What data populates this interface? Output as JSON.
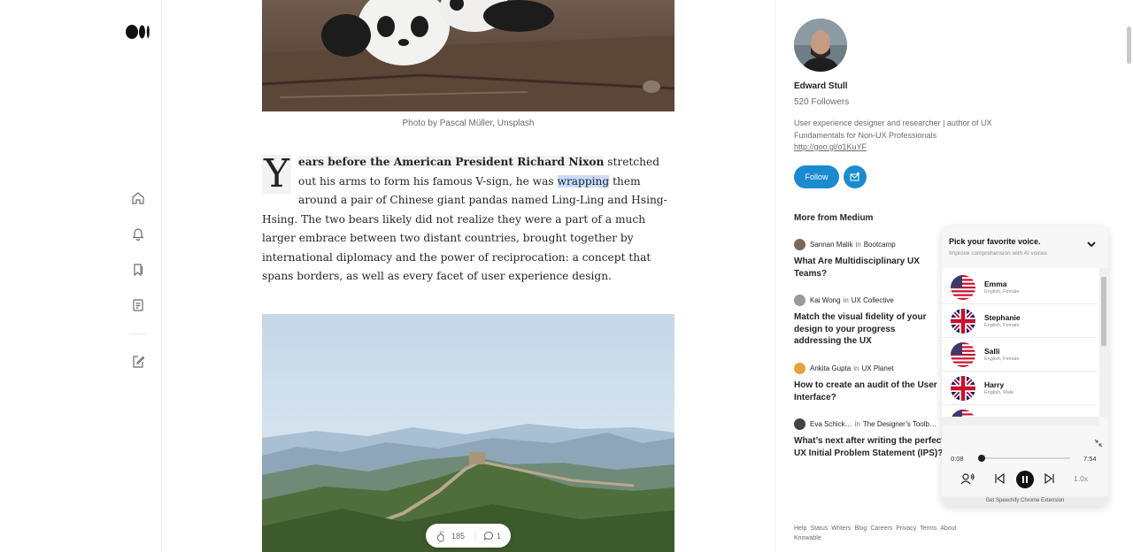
{
  "article": {
    "caption": "Photo by Pascal Müller, Unsplash",
    "dropcap": "Y",
    "lead_bold": "ears before the American President Richard Nixon",
    "lead_rest": " stretched out his arms to form his famous V-sign, he was ",
    "selected_word": "wrapping",
    "body": " them around a pair of Chinese giant pandas named Ling-Ling and Hsing-Hsing. The two bears likely did not realize they were a part of a much larger embrace between two distant countries, brought together by international diplomacy and the power of reciprocation: a concept that spans borders, as well as every facet of user experience design.",
    "claps": "185",
    "comments": "1"
  },
  "author": {
    "name": "Edward Stull",
    "followers": "520 Followers",
    "bio": "User experience designer and researcher | author of UX Fundamentals for Non-UX Professionals",
    "bio_link": "http://goo.gl/o1KuYF",
    "follow_label": "Follow"
  },
  "more_from": {
    "title": "More from Medium",
    "items": [
      {
        "author": "Sannan Malik",
        "in": "in",
        "publication": "Bootcamp",
        "title": "What Are Multidisciplinary UX Teams?",
        "avatar_color": "#7a6a5a"
      },
      {
        "author": "Kai Wong",
        "in": "in",
        "publication": "UX Collective",
        "title": "Match the visual fidelity of your design to your progress addressing the UX",
        "avatar_color": "#9a9a9a"
      },
      {
        "author": "Ankita Gupta",
        "in": "in",
        "publication": "UX Planet",
        "title": "How to create an audit of the User Interface?",
        "avatar_color": "#e8a23a"
      },
      {
        "author": "Eva Schick…",
        "in": "in",
        "publication": "The Designer’s Toolb…",
        "title": "What’s next after writing the perfect UX Initial Problem Statement (IPS)?",
        "avatar_color": "#444444"
      }
    ]
  },
  "footer": {
    "links": [
      "Help",
      "Status",
      "Writers",
      "Blog",
      "Careers",
      "Privacy",
      "Terms",
      "About",
      "Knowable"
    ]
  },
  "speechify": {
    "title": "Pick your favorite voice.",
    "subtitle": "Improve comprehension with AI voices",
    "voices": [
      {
        "name": "Emma",
        "meta": "English, Female",
        "flag": "us"
      },
      {
        "name": "Stephanie",
        "meta": "English, Female",
        "flag": "uk"
      },
      {
        "name": "Salli",
        "meta": "English, Female",
        "flag": "us"
      },
      {
        "name": "Harry",
        "meta": "English, Male",
        "flag": "uk"
      }
    ],
    "time_elapsed": "0:08",
    "time_total": "7:54",
    "progress": 0.017,
    "speed": "1.0x",
    "footer": "Get Speechify Chrome Extension"
  },
  "colors": {
    "accent_blue": "#1b8bd0",
    "selection": "#c9dcff"
  }
}
